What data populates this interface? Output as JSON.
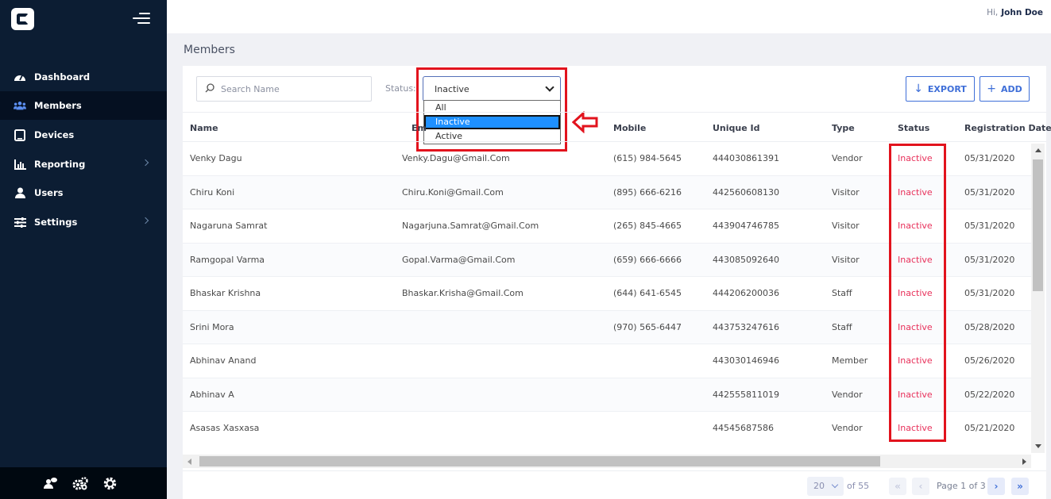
{
  "header": {
    "greeting_prefix": "Hi,",
    "user_name": "John Doe"
  },
  "sidebar": {
    "items": [
      {
        "label": "Dashboard",
        "icon": "dashboard-icon",
        "active": false,
        "has_submenu": false
      },
      {
        "label": "Members",
        "icon": "members-icon",
        "active": true,
        "has_submenu": false
      },
      {
        "label": "Devices",
        "icon": "tablet-icon",
        "active": false,
        "has_submenu": false
      },
      {
        "label": "Reporting",
        "icon": "bar-chart-icon",
        "active": false,
        "has_submenu": true
      },
      {
        "label": "Users",
        "icon": "user-icon",
        "active": false,
        "has_submenu": false
      },
      {
        "label": "Settings",
        "icon": "sliders-icon",
        "active": false,
        "has_submenu": true
      }
    ],
    "footer_icons": [
      "user-chat-icon",
      "cogs-icon",
      "gear-icon"
    ]
  },
  "page": {
    "title": "Members"
  },
  "toolbar": {
    "search_placeholder": "Search Name",
    "status_label": "Status:",
    "status_value": "Inactive",
    "status_options": [
      "All",
      "Inactive",
      "Active"
    ],
    "export_label": "EXPORT",
    "add_label": "ADD"
  },
  "table": {
    "columns": [
      "Name",
      "Em",
      "Mobile",
      "Unique Id",
      "Type",
      "Status",
      "Registration Date"
    ],
    "rows": [
      {
        "name": "Venky Dagu",
        "email": "Venky.Dagu@Gmail.Com",
        "mobile": "(615) 984-5645",
        "uid": "444030861391",
        "type": "Vendor",
        "status": "Inactive",
        "date": "05/31/2020"
      },
      {
        "name": "Chiru Koni",
        "email": "Chiru.Koni@Gmail.Com",
        "mobile": "(895) 666-6216",
        "uid": "442560608130",
        "type": "Visitor",
        "status": "Inactive",
        "date": "05/31/2020"
      },
      {
        "name": "Nagaruna Samrat",
        "email": "Nagarjuna.Samrat@Gmail.Com",
        "mobile": "(265) 845-4665",
        "uid": "443904746785",
        "type": "Visitor",
        "status": "Inactive",
        "date": "05/31/2020"
      },
      {
        "name": "Ramgopal Varma",
        "email": "Gopal.Varma@Gmail.Com",
        "mobile": "(659) 666-6666",
        "uid": "443085092640",
        "type": "Visitor",
        "status": "Inactive",
        "date": "05/31/2020"
      },
      {
        "name": "Bhaskar Krishna",
        "email": "Bhaskar.Krisha@Gmail.Com",
        "mobile": "(644) 641-6545",
        "uid": "444206200036",
        "type": "Staff",
        "status": "Inactive",
        "date": "05/31/2020"
      },
      {
        "name": "Srini Mora",
        "email": "",
        "mobile": "(970) 565-6447",
        "uid": "443753247616",
        "type": "Staff",
        "status": "Inactive",
        "date": "05/28/2020"
      },
      {
        "name": "Abhinav Anand",
        "email": "",
        "mobile": "",
        "uid": "443030146946",
        "type": "Member",
        "status": "Inactive",
        "date": "05/26/2020"
      },
      {
        "name": "Abhinav A",
        "email": "",
        "mobile": "",
        "uid": "442555811019",
        "type": "Vendor",
        "status": "Inactive",
        "date": "05/22/2020"
      },
      {
        "name": "Asasas Xasxasa",
        "email": "",
        "mobile": "",
        "uid": "44545687586",
        "type": "Vendor",
        "status": "Inactive",
        "date": "05/21/2020"
      }
    ]
  },
  "pager": {
    "page_size": "20",
    "of_total": "of 55",
    "page_text": "Page 1 of 3"
  },
  "colors": {
    "sidebar_bg": "#0c1d33",
    "accent": "#3f6fd8",
    "inactive": "#e8305a",
    "highlight": "#e2131d"
  }
}
